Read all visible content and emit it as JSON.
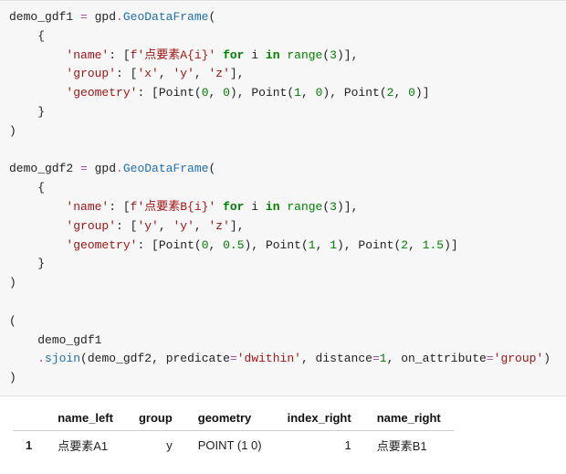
{
  "code": {
    "v_demo1": "demo_gdf1",
    "v_demo2": "demo_gdf2",
    "op_assign": " = ",
    "mod_gpd": "gpd",
    "dot": ".",
    "fn_GeoDataFrame": "GeoDataFrame",
    "p_open": "(",
    "p_close": ")",
    "b_open": "{",
    "b_close": "}",
    "sq_open": "[",
    "sq_close": "]",
    "comma": ", ",
    "colon": ": ",
    "k_name": "'name'",
    "k_group": "'group'",
    "k_geometry": "'geometry'",
    "fstr_A": "f'点要素A{i}'",
    "fstr_B": "f'点要素B{i}'",
    "kw_for": "for",
    "kw_in": "in",
    "var_i": "i",
    "fn_range": "range",
    "n3": "3",
    "g_x": "'x'",
    "g_y": "'y'",
    "g_z": "'z'",
    "fn_Point": "Point",
    "n0": "0",
    "n1": "1",
    "n2": "2",
    "f05": "0.5",
    "f15": "1.5",
    "fn_sjoin": "sjoin",
    "kw_predicate": "predicate",
    "v_dwithin": "'dwithin'",
    "kw_distance": "distance",
    "kw_on_attribute": "on_attribute",
    "v_group": "'group'"
  },
  "chart_data": {
    "type": "table",
    "columns": [
      "",
      "name_left",
      "group",
      "geometry",
      "index_right",
      "name_right"
    ],
    "rows": [
      [
        "1",
        "点要素A1",
        "y",
        "POINT (1 0)",
        "1",
        "点要素B1"
      ]
    ]
  }
}
